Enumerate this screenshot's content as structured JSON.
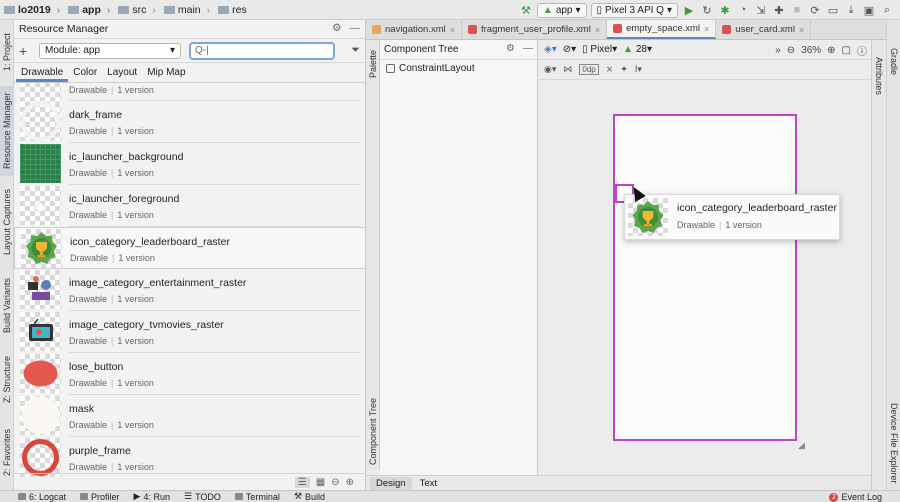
{
  "breadcrumb": [
    "lo2019",
    "app",
    "src",
    "main",
    "res"
  ],
  "toolbar": {
    "module_combo": "app",
    "device_combo": "Pixel 3 API Q"
  },
  "resource_manager": {
    "title": "Resource Manager",
    "module_select": "Module: app",
    "search_value": "Q-|",
    "tabs": [
      "Drawable",
      "Color",
      "Layout",
      "Mip Map"
    ],
    "items": [
      {
        "name": "",
        "type": "Drawable",
        "versions": "1 version",
        "thumb": "partial"
      },
      {
        "name": "dark_frame",
        "type": "Drawable",
        "versions": "1 version",
        "thumb": "ring"
      },
      {
        "name": "ic_launcher_background",
        "type": "Drawable",
        "versions": "1 version",
        "thumb": "green-grid"
      },
      {
        "name": "ic_launcher_foreground",
        "type": "Drawable",
        "versions": "1 version",
        "thumb": "white-logo"
      },
      {
        "name": "icon_category_leaderboard_raster",
        "type": "Drawable",
        "versions": "1 version",
        "thumb": "trophy"
      },
      {
        "name": "image_category_entertainment_raster",
        "type": "Drawable",
        "versions": "1 version",
        "thumb": "entertainment"
      },
      {
        "name": "image_category_tvmovies_raster",
        "type": "Drawable",
        "versions": "1 version",
        "thumb": "tv"
      },
      {
        "name": "lose_button",
        "type": "Drawable",
        "versions": "1 version",
        "thumb": "red-circle"
      },
      {
        "name": "mask",
        "type": "Drawable",
        "versions": "1 version",
        "thumb": "white-circle"
      },
      {
        "name": "purple_frame",
        "type": "Drawable",
        "versions": "1 version",
        "thumb": "red-ring"
      }
    ]
  },
  "editor_tabs": [
    {
      "label": "navigation.xml",
      "color": "#e8a65a"
    },
    {
      "label": "fragment_user_profile.xml",
      "color": "#d9534f"
    },
    {
      "label": "empty_space.xml",
      "color": "#d9534f"
    },
    {
      "label": "user_card.xml",
      "color": "#d9534f"
    }
  ],
  "left_strip_tabs": [
    "1: Project",
    "Resource Manager",
    "Layout Captures",
    "Build Variants",
    "Z: Structure",
    "2: Favorites"
  ],
  "palette_label": "Palette",
  "component_tree": {
    "title": "Component Tree",
    "items": [
      "ConstraintLayout"
    ],
    "side_label": "Component Tree"
  },
  "design_toolbar": {
    "device": "Pixel",
    "api": "28",
    "zoom": "36%",
    "dp_label": "0dp"
  },
  "drag_card": {
    "name": "icon_category_leaderboard_raster",
    "type": "Drawable",
    "versions": "1 version"
  },
  "bottom_tabs": [
    "Design",
    "Text"
  ],
  "right_strip_tabs": [
    "Gradle",
    "Attributes",
    "Device File Explorer"
  ],
  "statusbar": {
    "items": [
      "6: Logcat",
      "Profiler",
      "4: Run",
      "TODO",
      "Terminal",
      "Build"
    ],
    "event_log": "Event Log",
    "event_count": "2"
  },
  "colors": {
    "accent": "#5c86c2",
    "selection": "#c042c8",
    "run": "#3c9b3c"
  }
}
